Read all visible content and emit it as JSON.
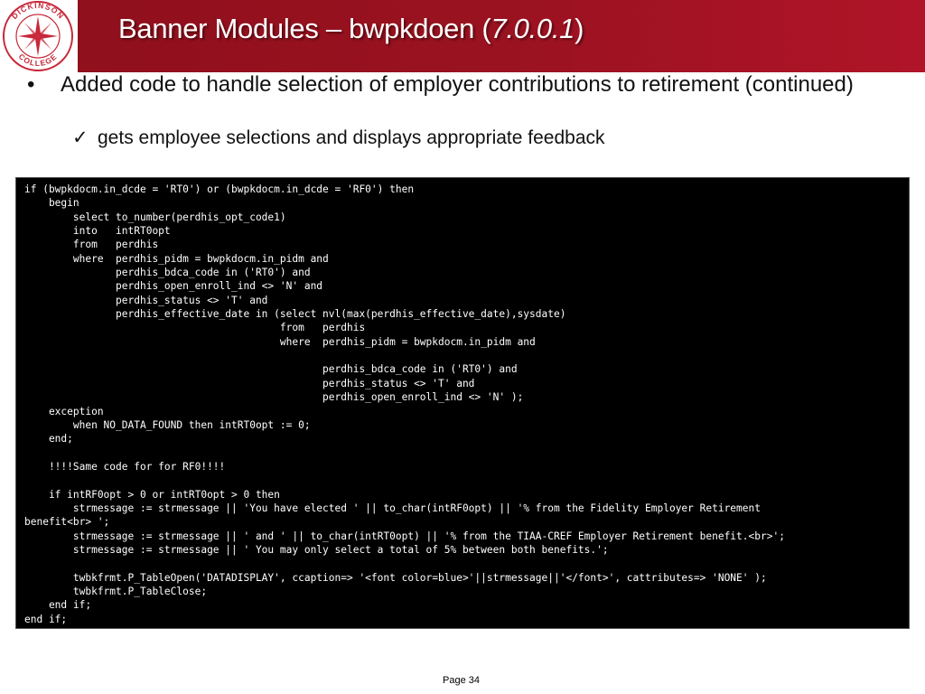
{
  "slide": {
    "title": "Banner Modules – bwpkdoen (",
    "title_version": "7.0.0.1",
    "title_close": ")",
    "logo_top_text": "DICKINSON",
    "logo_bottom_text": "COLLEGE",
    "bullet_1": "Added code to handle selection of employer contributions to retirement (continued)",
    "bullet_1_marker": "•",
    "bullet_2_marker": "✓",
    "bullet_2": "gets employee selections and displays appropriate feedback",
    "page_label": "Page 34"
  },
  "code_lines": [
    "if (bwpkdocm.in_dcde = 'RT0') or (bwpkdocm.in_dcde = 'RF0') then",
    "    begin",
    "        select to_number(perdhis_opt_code1)",
    "        into   intRT0opt",
    "        from   perdhis",
    "        where  perdhis_pidm = bwpkdocm.in_pidm and",
    "               perdhis_bdca_code in ('RT0') and",
    "               perdhis_open_enroll_ind <> 'N' and",
    "               perdhis_status <> 'T' and",
    "               perdhis_effective_date in (select nvl(max(perdhis_effective_date),sysdate)",
    "                                          from   perdhis",
    "                                          where  perdhis_pidm = bwpkdocm.in_pidm and",
    "",
    "                                                 perdhis_bdca_code in ('RT0') and",
    "                                                 perdhis_status <> 'T' and",
    "                                                 perdhis_open_enroll_ind <> 'N' );",
    "    exception",
    "        when NO_DATA_FOUND then intRT0opt := 0;",
    "    end;",
    "",
    "    !!!!Same code for for RF0!!!!",
    "",
    "    if intRF0opt > 0 or intRT0opt > 0 then",
    "        strmessage := strmessage || 'You have elected ' || to_char(intRF0opt) || '% from the Fidelity Employer Retirement",
    "benefit<br> ';",
    "        strmessage := strmessage || ' and ' || to_char(intRT0opt) || '% from the TIAA-CREF Employer Retirement benefit.<br>';",
    "        strmessage := strmessage || ' You may only select a total of 5% between both benefits.';",
    "",
    "        twbkfrmt.P_TableOpen('DATADISPLAY', ccaption=> '<font color=blue>'||strmessage||'</font>', cattributes=> 'NONE' );",
    "        twbkfrmt.P_TableClose;",
    "    end if;",
    "end if;"
  ],
  "colors": {
    "header_red": "#9a1220",
    "code_background": "#000000",
    "code_text": "#ffffff"
  }
}
